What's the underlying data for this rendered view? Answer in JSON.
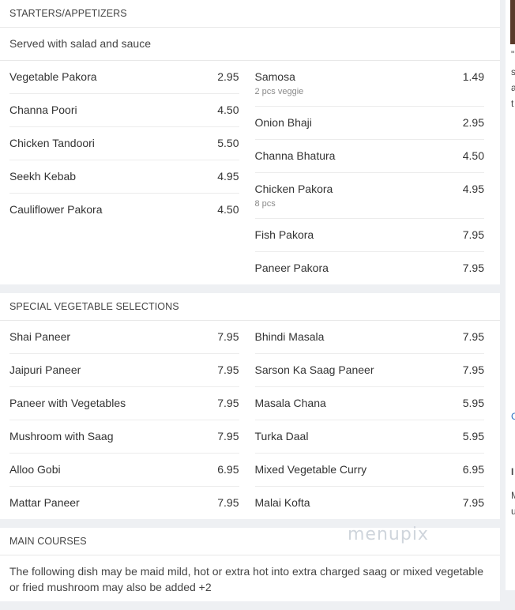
{
  "starters": {
    "title": "STARTERS/APPETIZERS",
    "description": "Served with salad and sauce",
    "left": [
      {
        "name": "Vegetable Pakora",
        "price": "2.95"
      },
      {
        "name": "Channa Poori",
        "price": "4.50"
      },
      {
        "name": "Chicken Tandoori",
        "price": "5.50"
      },
      {
        "name": "Seekh Kebab",
        "price": "4.95"
      },
      {
        "name": "Cauliflower Pakora",
        "price": "4.50"
      }
    ],
    "right": [
      {
        "name": "Samosa",
        "price": "1.49",
        "note": "2 pcs veggie"
      },
      {
        "name": "Onion Bhaji",
        "price": "2.95"
      },
      {
        "name": "Channa Bhatura",
        "price": "4.50"
      },
      {
        "name": "Chicken Pakora",
        "price": "4.95",
        "note": "8 pcs"
      },
      {
        "name": "Fish Pakora",
        "price": "7.95"
      },
      {
        "name": "Paneer Pakora",
        "price": "7.95"
      }
    ]
  },
  "vegetable": {
    "title": "SPECIAL VEGETABLE SELECTIONS",
    "left": [
      {
        "name": "Shai Paneer",
        "price": "7.95"
      },
      {
        "name": "Jaipuri Paneer",
        "price": "7.95"
      },
      {
        "name": "Paneer with Vegetables",
        "price": "7.95"
      },
      {
        "name": "Mushroom with Saag",
        "price": "7.95"
      },
      {
        "name": "Alloo Gobi",
        "price": "6.95"
      },
      {
        "name": "Mattar Paneer",
        "price": "7.95"
      }
    ],
    "right": [
      {
        "name": "Bhindi Masala",
        "price": "7.95"
      },
      {
        "name": "Sarson Ka Saag Paneer",
        "price": "7.95"
      },
      {
        "name": "Masala Chana",
        "price": "5.95"
      },
      {
        "name": "Turka Daal",
        "price": "5.95"
      },
      {
        "name": "Mixed Vegetable Curry",
        "price": "6.95"
      },
      {
        "name": "Malai Kofta",
        "price": "7.95"
      }
    ]
  },
  "main_courses": {
    "title": "MAIN COURSES",
    "description": "The following dish may be maid mild, hot or extra hot into extra charged saag or mixed vegetable or fried mushroom may also be added +2"
  },
  "watermark": "menupix"
}
